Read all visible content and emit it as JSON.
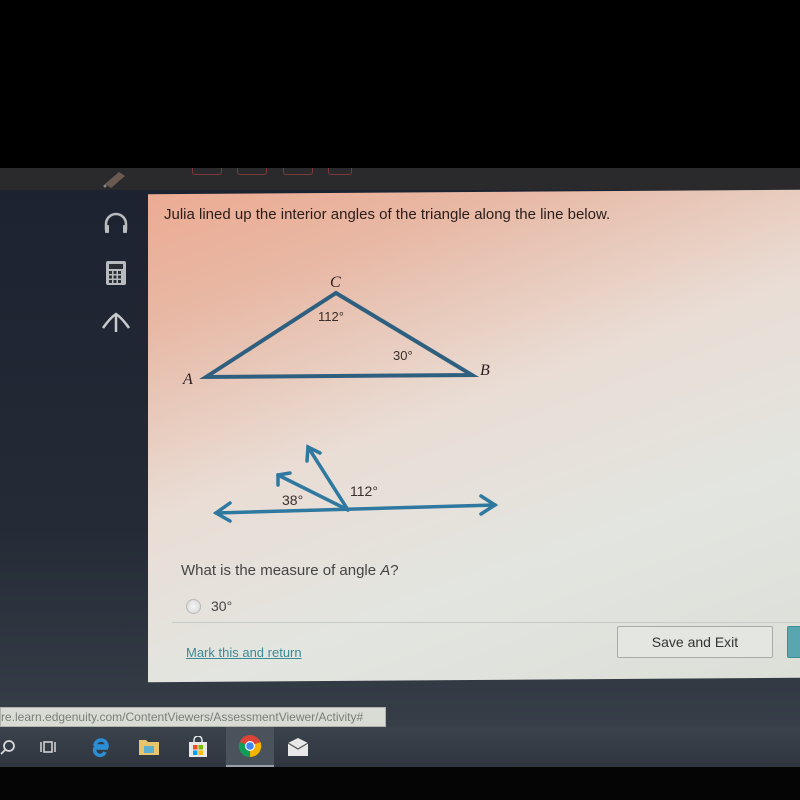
{
  "question": {
    "text": "Julia lined up the interior angles of the triangle along the line below."
  },
  "triangle": {
    "vertices": {
      "A": "A",
      "B": "B",
      "C": "C"
    },
    "angle_C_label": "112°",
    "angle_B_label": "30°",
    "stroke_color": "#2f5f7f"
  },
  "line_diagram": {
    "left_angle_label": "38°",
    "right_angle_label": "112°",
    "stroke_color": "#2f78a0"
  },
  "prompt": {
    "prefix": "What is the measure of angle ",
    "variable": "A",
    "suffix": "?"
  },
  "options": [
    {
      "label": "30°",
      "selected": false
    }
  ],
  "footer": {
    "mark_link": "Mark this and return",
    "save_button": "Save and Exit"
  },
  "sidebar": {
    "icons": [
      "pencil-icon",
      "headphones-icon",
      "calculator-icon",
      "reference-icon"
    ]
  },
  "browser": {
    "status_url": "re.learn.edgenuity.com/ContentViewers/AssessmentViewer/Activity#"
  },
  "taskbar": {
    "icons": [
      "search-icon",
      "task-view-icon",
      "edge-icon",
      "file-explorer-icon",
      "store-icon",
      "chrome-icon",
      "mail-icon"
    ],
    "active": "chrome-icon"
  }
}
